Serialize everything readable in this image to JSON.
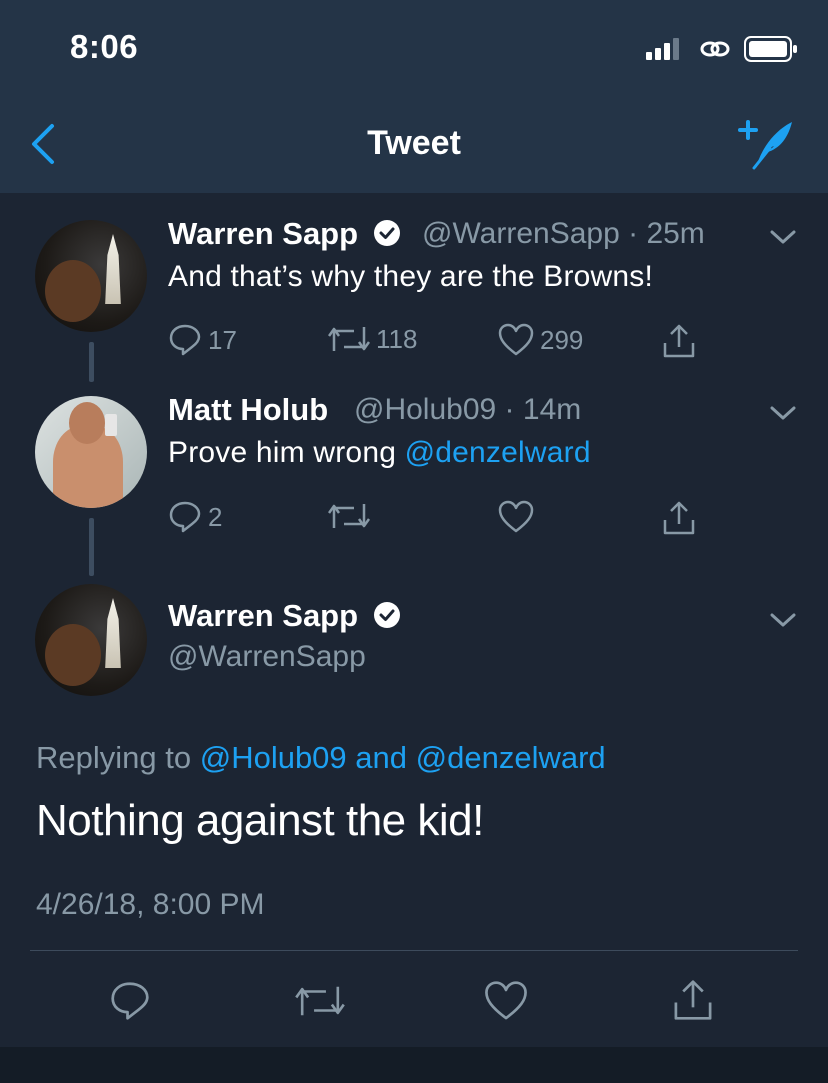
{
  "status_bar": {
    "time": "8:06"
  },
  "nav": {
    "title": "Tweet"
  },
  "tweets": [
    {
      "name": "Warren Sapp",
      "handle": "@WarrenSapp",
      "time": "25m",
      "text": "And that’s why they are the Browns!",
      "replies": "17",
      "retweets": "118",
      "likes": "299"
    },
    {
      "name": "Matt Holub",
      "handle": "@Holub09",
      "time": "14m",
      "text_prefix": "Prove him wrong ",
      "text_mention": "@denzelward",
      "replies": "2"
    }
  ],
  "main_tweet": {
    "name": "Warren Sapp",
    "handle": "@WarrenSapp",
    "replying_label": "Replying to",
    "replying_user1": "@Holub09",
    "replying_and": "and",
    "replying_user2": "@denzelward",
    "text": "Nothing against the kid!",
    "timestamp": "4/26/18, 8:00 PM"
  },
  "colors": {
    "background": "#1c2533",
    "header": "#243447",
    "accent": "#1da1f2",
    "muted": "#8899a6"
  },
  "icons": [
    "back-chevron-icon",
    "compose-quill-icon",
    "verified-icon",
    "reply-icon",
    "retweet-icon",
    "like-icon",
    "share-icon",
    "chevron-down-icon"
  ]
}
